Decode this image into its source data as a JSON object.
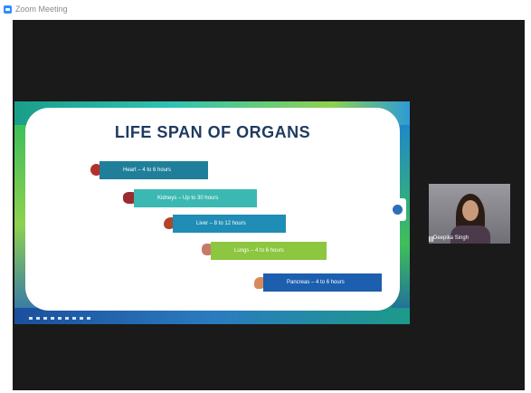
{
  "window": {
    "title": "Zoom Meeting",
    "app_icon": "zoom-icon"
  },
  "slide": {
    "title": "LIFE SPAN OF ORGANS",
    "items": [
      {
        "label": "Heart – 4 to 6 hours",
        "icon": "heart-organ-icon"
      },
      {
        "label": "Kidneys – Up to 30 hours",
        "icon": "kidneys-organ-icon"
      },
      {
        "label": "Liver – 8 to 12 hours",
        "icon": "liver-organ-icon"
      },
      {
        "label": "Lungs – 4 to 6 hours",
        "icon": "lungs-organ-icon"
      },
      {
        "label": "Pancreas – 4 to 6 hours",
        "icon": "pancreas-organ-icon"
      }
    ],
    "colors": {
      "heart": "#1f7f9a",
      "kidneys": "#3bb8b2",
      "liver": "#1f8db5",
      "lungs": "#8dc63f",
      "pancreas": "#1c5fae",
      "title": "#1f3a5f"
    }
  },
  "participant": {
    "name": "Deepika Singh",
    "icon": "signal-bars-icon"
  },
  "controls": {
    "side_toggle_icon": "expand-panel-icon"
  }
}
